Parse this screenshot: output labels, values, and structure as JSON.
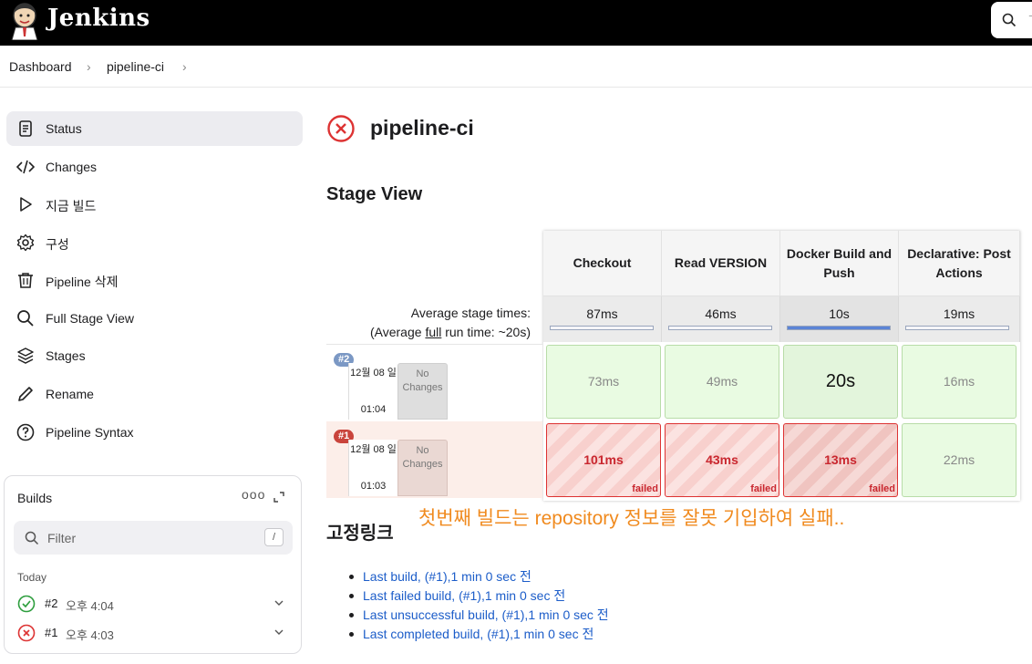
{
  "app": {
    "brand": "Jenkins",
    "search_placeholder": "ᄀ"
  },
  "breadcrumb": {
    "items": [
      "Dashboard",
      "pipeline-ci"
    ],
    "separator": "›"
  },
  "sidebar": {
    "items": [
      {
        "label": "Status",
        "icon": "document-icon",
        "active": true
      },
      {
        "label": "Changes",
        "icon": "code-icon"
      },
      {
        "label": "지금 빌드",
        "icon": "play-icon"
      },
      {
        "label": "구성",
        "icon": "gear-icon"
      },
      {
        "label": "Pipeline 삭제",
        "icon": "trash-icon"
      },
      {
        "label": "Full Stage View",
        "icon": "search-icon"
      },
      {
        "label": "Stages",
        "icon": "layers-icon"
      },
      {
        "label": "Rename",
        "icon": "pencil-icon"
      },
      {
        "label": "Pipeline Syntax",
        "icon": "help-icon"
      }
    ]
  },
  "builds": {
    "title": "Builds",
    "more": "ooo",
    "filter_placeholder": "Filter",
    "filter_shortcut": "/",
    "group_label": "Today",
    "items": [
      {
        "number": "#2",
        "time": "오후 4:04",
        "status": "success"
      },
      {
        "number": "#1",
        "time": "오후 4:03",
        "status": "failed"
      }
    ]
  },
  "main": {
    "title": "pipeline-ci",
    "status": "failed",
    "stage_view_heading": "Stage View",
    "avg_label_line1": "Average stage times:",
    "avg_label_line2_prefix": "(Average ",
    "avg_label_line2_link": "full",
    "avg_label_line2_suffix": " run time: ~20s)",
    "stages": [
      {
        "name": "Checkout",
        "avg": "87ms",
        "avg_fraction": 0.0
      },
      {
        "name": "Read VERSION",
        "avg": "46ms",
        "avg_fraction": 0.0
      },
      {
        "name": "Docker Build and Push",
        "avg": "10s",
        "avg_fraction": 1.0
      },
      {
        "name": "Declarative: Post Actions",
        "avg": "19ms",
        "avg_fraction": 0.0
      }
    ],
    "runs": [
      {
        "badge": "#2",
        "date": "12월 08 일",
        "time": "01:04",
        "changes": "No Changes",
        "status": "success",
        "cells": [
          "73ms",
          "49ms",
          "20s",
          "16ms"
        ]
      },
      {
        "badge": "#1",
        "date": "12월 08 일",
        "time": "01:03",
        "changes": "No Changes",
        "status": "failed",
        "cells": [
          "101ms",
          "43ms",
          "13ms",
          "22ms"
        ],
        "failed_label": "failed"
      }
    ],
    "annotation": "첫번째 빌드는 repository 정보를 잘못 기입하여 실패..",
    "permalinks_heading": "고정링크",
    "permalinks": [
      "Last build, (#1),1 min 0 sec 전",
      "Last failed build, (#1),1 min 0 sec 전",
      "Last unsuccessful build, (#1),1 min 0 sec 전",
      "Last completed build, (#1),1 min 0 sec 전"
    ]
  },
  "colors": {
    "failed": "#d33",
    "success": "#2e9e3e",
    "link": "#1c5dc9",
    "annotation": "#f08a1e",
    "badge_success": "#7b98c4",
    "badge_failed": "#c9443c"
  }
}
